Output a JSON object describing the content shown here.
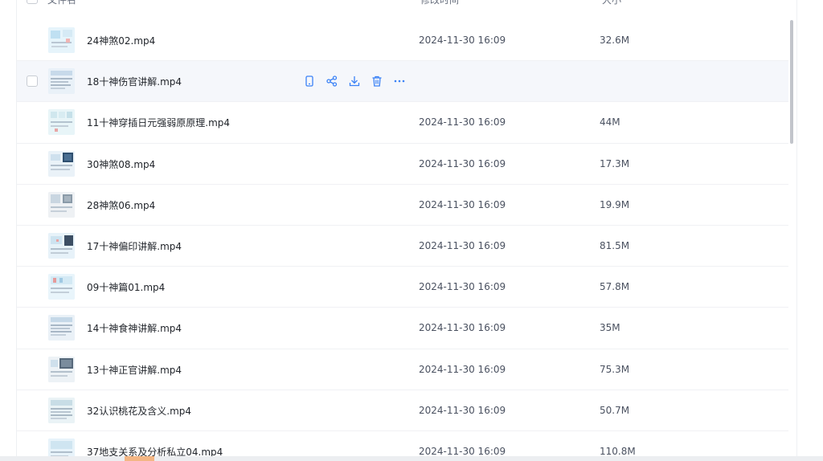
{
  "header": {
    "name_label": "文件名",
    "time_label": "修改时间",
    "size_label": "大小"
  },
  "row_actions": [
    "phone-icon",
    "share-icon",
    "download-icon",
    "delete-icon",
    "more-icon"
  ],
  "files": [
    {
      "name": "24神煞02.mp4",
      "time": "2024-11-30 16:09",
      "size": "32.6M"
    },
    {
      "name": "18十神伤官讲解.mp4",
      "time": "",
      "size": ""
    },
    {
      "name": "11十神穿插日元强弱原原理.mp4",
      "time": "2024-11-30 16:09",
      "size": "44M"
    },
    {
      "name": "30神煞08.mp4",
      "time": "2024-11-30 16:09",
      "size": "17.3M"
    },
    {
      "name": "28神煞06.mp4",
      "time": "2024-11-30 16:09",
      "size": "19.9M"
    },
    {
      "name": "17十神偏印讲解.mp4",
      "time": "2024-11-30 16:09",
      "size": "81.5M"
    },
    {
      "name": "09十神篇01.mp4",
      "time": "2024-11-30 16:09",
      "size": "57.8M"
    },
    {
      "name": "14十神食神讲解.mp4",
      "time": "2024-11-30 16:09",
      "size": "35M"
    },
    {
      "name": "13十神正官讲解.mp4",
      "time": "2024-11-30 16:09",
      "size": "75.3M"
    },
    {
      "name": "32认识桃花及含义.mp4",
      "time": "2024-11-30 16:09",
      "size": "50.7M"
    },
    {
      "name": "37地支关系及分析私立04.mp4",
      "time": "2024-11-30 16:09",
      "size": "110.8M"
    }
  ],
  "colors": {
    "accent": "#3b82f6",
    "hover_row": "#f5f7fb",
    "text": "#1f2329",
    "muted": "#4a5160"
  }
}
